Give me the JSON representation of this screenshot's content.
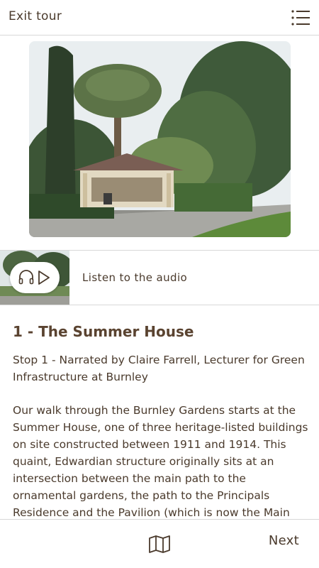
{
  "header": {
    "exit_label": "Exit tour",
    "menu_icon": "list-menu-icon"
  },
  "hero": {
    "image_name": "summer-house-photo"
  },
  "audio": {
    "label": "Listen to the audio",
    "icons": [
      "headphones-icon",
      "play-icon"
    ]
  },
  "stop": {
    "title": "1 - The Summer House",
    "subtitle": "Stop 1 - Narrated by Claire Farrell, Lecturer for Green Infrastructure at Burnley",
    "body": "Our walk through the Burnley Gardens starts at the Summer House, one of three heritage-listed buildings on site constructed between 1911 and 1914. This quaint, Edwardian structure originally sits at an intersection between the main path to the ornamental gardens, the path to the Principals Residence and the Pavilion (which is now the Main"
  },
  "footer": {
    "map_icon": "map-icon",
    "next_label": "Next"
  },
  "colors": {
    "text": "#4a3a2c",
    "title": "#5a4330",
    "divider": "#d8d8d8"
  }
}
